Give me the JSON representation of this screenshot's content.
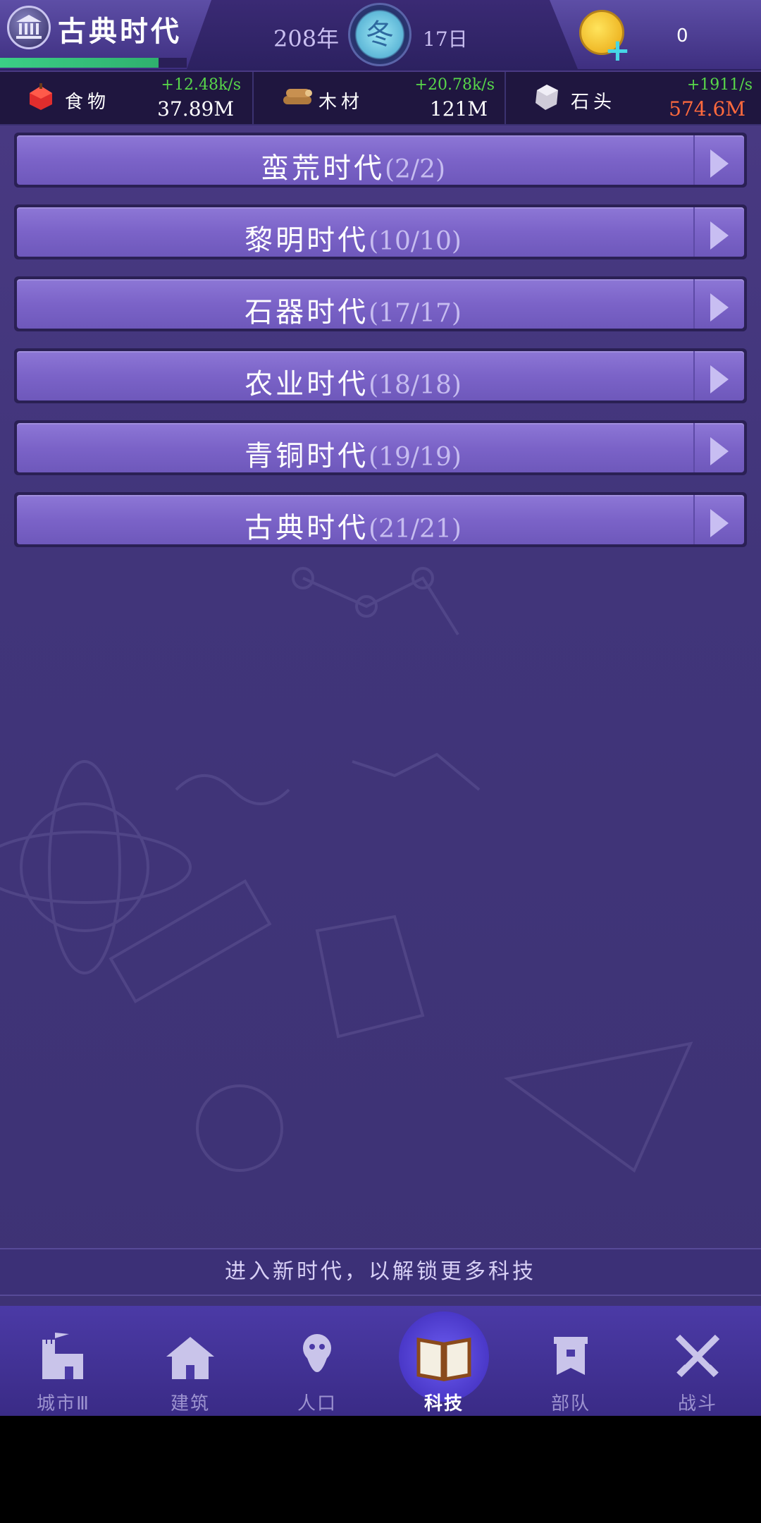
{
  "header": {
    "era_title": "古典时代",
    "era_progress": 0.85,
    "year": "208年",
    "season": "冬",
    "day": "17日",
    "coins": "0"
  },
  "resources": [
    {
      "name": "食物",
      "icon": "apple-icon",
      "rate": "+12.48k/s",
      "amount": "37.89M"
    },
    {
      "name": "木材",
      "icon": "wood-icon",
      "rate": "+20.78k/s",
      "amount": "121M"
    },
    {
      "name": "石头",
      "icon": "stone-icon",
      "rate": "+1911/s",
      "amount": "574.6M"
    }
  ],
  "eras": [
    {
      "name": "蛮荒时代",
      "count": "(2/2)"
    },
    {
      "name": "黎明时代",
      "count": "(10/10)"
    },
    {
      "name": "石器时代",
      "count": "(17/17)"
    },
    {
      "name": "农业时代",
      "count": "(18/18)"
    },
    {
      "name": "青铜时代",
      "count": "(19/19)"
    },
    {
      "name": "古典时代",
      "count": "(21/21)"
    }
  ],
  "hint": "进入新时代，以解锁更多科技",
  "nav": [
    {
      "label": "城市Ⅲ",
      "icon": "castle-icon"
    },
    {
      "label": "建筑",
      "icon": "house-icon"
    },
    {
      "label": "人口",
      "icon": "person-icon"
    },
    {
      "label": "科技",
      "icon": "book-icon",
      "active": true
    },
    {
      "label": "部队",
      "icon": "banner-icon"
    },
    {
      "label": "战斗",
      "icon": "crossed-swords-icon"
    }
  ],
  "colors": {
    "rate_green": "#58d84a",
    "warning_amount": "#ff6a3d",
    "button_purple": "#7b63c8"
  }
}
